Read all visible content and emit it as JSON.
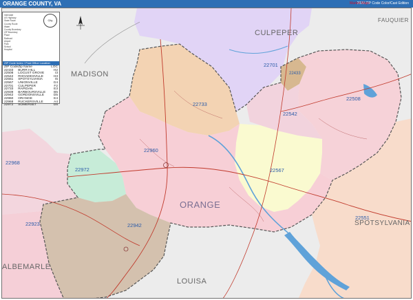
{
  "header": {
    "title": "ORANGE COUNTY, VA",
    "edition": "2020 ZIP Code Color/Cast Edition"
  },
  "map": {
    "county_name": "ORANGE",
    "neighbors": [
      {
        "key": "culpeper",
        "label": "CULPEPER"
      },
      {
        "key": "madison",
        "label": "MADISON"
      },
      {
        "key": "fauquier",
        "label": "FAUQUIER"
      },
      {
        "key": "spotsylvania",
        "label": "SPOTSYLVANIA"
      },
      {
        "key": "albemarle",
        "label": "ALBEMARLE"
      },
      {
        "key": "louisa",
        "label": "LOUISA"
      }
    ],
    "zip_labels": [
      {
        "key": "z22701",
        "label": "22701"
      },
      {
        "key": "z22433",
        "label": "22433"
      },
      {
        "key": "z22508",
        "label": "22508"
      },
      {
        "key": "z22733",
        "label": "22733"
      },
      {
        "key": "z22542",
        "label": "22542"
      },
      {
        "key": "z22960",
        "label": "22960"
      },
      {
        "key": "z22567",
        "label": "22567"
      },
      {
        "key": "z22968",
        "label": "22968"
      },
      {
        "key": "z22972",
        "label": "22972"
      },
      {
        "key": "z22923",
        "label": "22923"
      },
      {
        "key": "z22942",
        "label": "22942"
      },
      {
        "key": "z22551",
        "label": "22551"
      }
    ],
    "colors": {
      "culpeper_zone": "#e1d4f6",
      "z22733": "#f3d3b3",
      "z22508": "#f6d2d8",
      "z22567": "#fafad0",
      "z22960": "#f7cfd6",
      "z22972": "#c7ecd8",
      "z22942": "#d4c1ae",
      "outside": "#ececec",
      "spotsylvania_zone": "#f8dccb",
      "water": "#5fa2d9",
      "roads": "#c0392b"
    }
  },
  "legend": {
    "seal_label": "City",
    "key_items": [
      "Interstate",
      "US Highway",
      "State Route",
      "County Route",
      "Water",
      "County Boundary",
      "ZIP Boundary",
      "Place",
      "Railroad",
      "Airport",
      "Park",
      "School",
      "Hospital"
    ],
    "table_header": "ZIP Code Index / Post Office Location",
    "columns": [
      "ZIP Code",
      "Zip Name",
      "LOC"
    ],
    "rows": [
      {
        "code": "22433",
        "name": "BURR HILL",
        "loc": "H2"
      },
      {
        "code": "22508",
        "name": "LOCUST GROVE",
        "loc": "I3"
      },
      {
        "code": "22542",
        "name": "RHOADESVILLE",
        "loc": "H3"
      },
      {
        "code": "22551",
        "name": "SPOTSYLVANIA",
        "loc": "I5"
      },
      {
        "code": "22567",
        "name": "UNIONVILLE",
        "loc": "G4"
      },
      {
        "code": "22701",
        "name": "CULPEPER",
        "loc": "F2"
      },
      {
        "code": "22733",
        "name": "RAPIDAN",
        "loc": "E3"
      },
      {
        "code": "22939",
        "name": "BARBOURSVILLE",
        "loc": "B5"
      },
      {
        "code": "22942",
        "name": "GORDONSVILLE",
        "loc": "D5"
      },
      {
        "code": "22960",
        "name": "ORANGE",
        "loc": "E4"
      },
      {
        "code": "22968",
        "name": "RUCKERSVILLE",
        "loc": "A4"
      },
      {
        "code": "22972",
        "name": "SOMERSET",
        "loc": "D5"
      }
    ]
  },
  "logo": {
    "text": "Market Maps"
  }
}
